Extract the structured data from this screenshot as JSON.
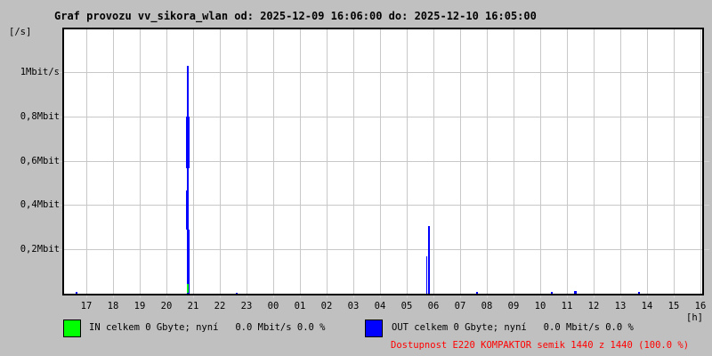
{
  "title": "Graf provozu vv_sikora_wlan od: 2025-12-09 16:06:00 do: 2025-12-10 16:05:00",
  "y_axis_unit": "[/s]",
  "x_axis_unit": "[h]",
  "legend": {
    "in_label": "IN celkem 0 Gbyte; nyní   0.0 Mbit/s 0.0 %",
    "out_label": "OUT celkem 0 Gbyte; nyní   0.0 Mbit/s 0.0 %",
    "in_color": "#00ff00",
    "out_color": "#0000ff"
  },
  "availability": {
    "text": "Dostupnost E220 KOMPAKTOR semik 1440 z 1440 (100.0 %)",
    "color": "#ff0000"
  },
  "colors": {
    "background": "#c0c0c0",
    "plot_background": "#ffffff",
    "grid": "#c8c8c8",
    "axis_border": "#000000"
  },
  "chart_data": {
    "type": "area",
    "title": "Graf provozu vv_sikora_wlan od: 2025-12-09 16:06:00 do: 2025-12-10 16:05:00",
    "time_window": {
      "from": "2025-12-09 16:06:00",
      "to": "2025-12-10 16:05:00"
    },
    "x_labels": [
      "17",
      "18",
      "19",
      "20",
      "21",
      "22",
      "23",
      "00",
      "01",
      "02",
      "03",
      "04",
      "05",
      "06",
      "07",
      "08",
      "09",
      "10",
      "11",
      "12",
      "13",
      "14",
      "15",
      "16"
    ],
    "xlabel_unit": "[h]",
    "ylabel_unit": "[/s]",
    "y_ticks": [
      {
        "label": "1Mbit/s",
        "value": 1.0
      },
      {
        "label": "0,8Mbit",
        "value": 0.8
      },
      {
        "label": "0,6Mbit",
        "value": 0.6
      },
      {
        "label": "0,4Mbit",
        "value": 0.4
      },
      {
        "label": "0,2Mbit",
        "value": 0.2
      }
    ],
    "ylim": [
      0,
      1.19
    ],
    "grid": true,
    "series": [
      {
        "name": "IN",
        "color": "#00ff00",
        "total": "0 Gbyte",
        "current_mbit": 0.0,
        "percent": 0.0
      },
      {
        "name": "OUT",
        "color": "#0000ff",
        "total": "0 Gbyte",
        "current_mbit": 0.0,
        "percent": 0.0
      }
    ],
    "events": [
      {
        "series": "OUT",
        "time": "≈20:46",
        "peak_mbit": 1.03
      },
      {
        "series": "OUT",
        "time": "≈05:48",
        "peak_mbit": 0.31
      },
      {
        "series": "IN",
        "time": "≈20:46",
        "peak_mbit": 0.04
      },
      {
        "series": "OUT",
        "time": "≈16:36",
        "peak_mbit": 0.01
      },
      {
        "series": "OUT",
        "time": "≈22:36",
        "peak_mbit": 0.01
      },
      {
        "series": "OUT",
        "time": "≈07:36",
        "peak_mbit": 0.01
      },
      {
        "series": "OUT",
        "time": "≈10:24",
        "peak_mbit": 0.01
      },
      {
        "series": "OUT",
        "time": "≈11:16",
        "peak_mbit": 0.013
      },
      {
        "series": "OUT",
        "time": "≈13:40",
        "peak_mbit": 0.01
      }
    ],
    "segments": [
      {
        "series": "OUT",
        "x_frac": 0.1925,
        "w": 2,
        "v1": 0,
        "v2": 1.028
      },
      {
        "series": "OUT",
        "x_frac": 0.1911,
        "w": 4,
        "v1": 0.566,
        "v2": 0.8
      },
      {
        "series": "OUT",
        "x_frac": 0.1911,
        "w": 3,
        "v1": 0.289,
        "v2": 0.466
      },
      {
        "series": "OUT",
        "x_frac": 0.1953,
        "w": 1,
        "v1": 0,
        "v2": 0.289
      },
      {
        "series": "OUT",
        "x_frac": 0.5676,
        "w": 1,
        "v1": 0,
        "v2": 0.169
      },
      {
        "series": "OUT",
        "x_frac": 0.5704,
        "w": 2,
        "v1": 0,
        "v2": 0.305
      },
      {
        "series": "OUT",
        "x_frac": 0.0181,
        "w": 2,
        "v1": 0,
        "v2": 0.01
      },
      {
        "series": "OUT",
        "x_frac": 0.2692,
        "w": 2,
        "v1": 0,
        "v2": 0.006
      },
      {
        "series": "OUT",
        "x_frac": 0.6457,
        "w": 2,
        "v1": 0,
        "v2": 0.01
      },
      {
        "series": "OUT",
        "x_frac": 0.7629,
        "w": 2,
        "v1": 0,
        "v2": 0.01
      },
      {
        "series": "OUT",
        "x_frac": 0.7992,
        "w": 3,
        "v1": 0,
        "v2": 0.013
      },
      {
        "series": "OUT",
        "x_frac": 0.8996,
        "w": 2,
        "v1": 0,
        "v2": 0.01
      },
      {
        "series": "IN",
        "x_frac": 0.1925,
        "w": 2,
        "v1": 0.004,
        "v2": 0.044
      }
    ]
  }
}
